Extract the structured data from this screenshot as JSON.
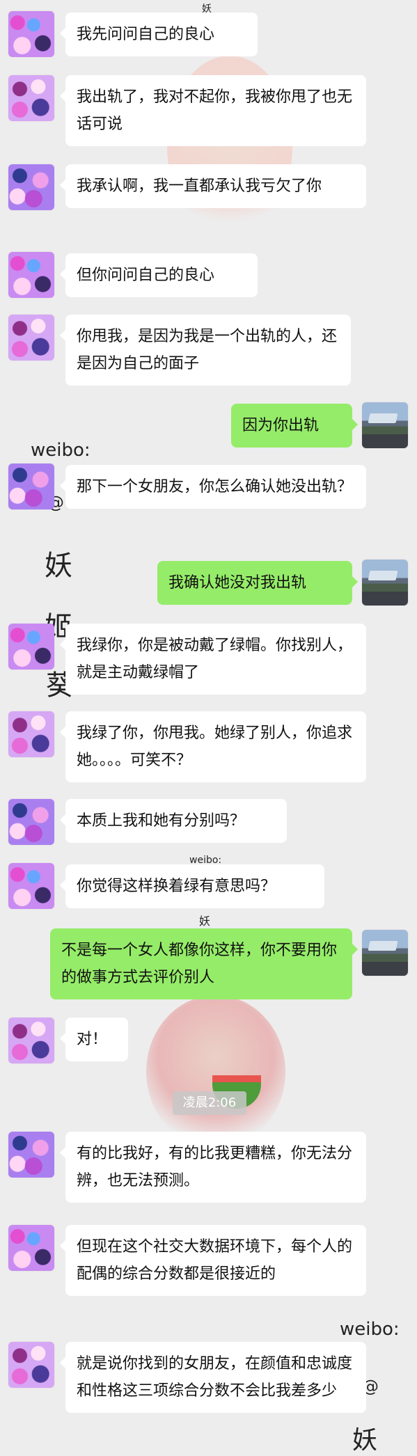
{
  "watermarks": {
    "top_small": "妖",
    "weibo_1": "weibo:",
    "at_1": "@",
    "yao_1": "妖",
    "ji_1": "姬",
    "kui_1": "葵",
    "weibo_small": "weibo:",
    "yao_small": "妖",
    "weibo_2": "weibo:",
    "at_2": "@",
    "yao_2": "妖"
  },
  "time_label": "凌晨2:06",
  "messages": [
    {
      "side": "left",
      "text": "我先问问自己的良心"
    },
    {
      "side": "left",
      "text": "我出轨了，我对不起你，我被你甩了也无话可说"
    },
    {
      "side": "left",
      "text": "我承认啊，我一直都承认我亏欠了你"
    },
    {
      "side": "left",
      "text": "但你问问自己的良心"
    },
    {
      "side": "left",
      "text": "你甩我，是因为我是一个出轨的人，还是因为自己的面子"
    },
    {
      "side": "right",
      "text": "因为你出轨"
    },
    {
      "side": "left",
      "text": "那下一个女朋友，你怎么确认她没出轨？"
    },
    {
      "side": "right",
      "text": "我确认她没对我出轨"
    },
    {
      "side": "left",
      "text": "我绿你，你是被动戴了绿帽。你找别人，就是主动戴绿帽了"
    },
    {
      "side": "left",
      "text": "我绿了你，你甩我。她绿了别人，你追求她。。。。可笑不？"
    },
    {
      "side": "left",
      "text": "本质上我和她有分别吗？"
    },
    {
      "side": "left",
      "text": "你觉得这样换着绿有意思吗？"
    },
    {
      "side": "right",
      "text": "不是每一个女人都像你这样，你不要用你的做事方式去评价别人"
    },
    {
      "side": "left",
      "text": "对！"
    },
    {
      "side": "left",
      "text": "有的比我好，有的比我更糟糕，你无法分辨，也无法预测。"
    },
    {
      "side": "left",
      "text": "但现在这个社交大数据环境下，每个人的配偶的综合分数都是很接近的"
    },
    {
      "side": "left",
      "text": "就是说你找到的女朋友，在颜值和忠诚度和性格这三项综合分数不会比我差多少"
    }
  ]
}
